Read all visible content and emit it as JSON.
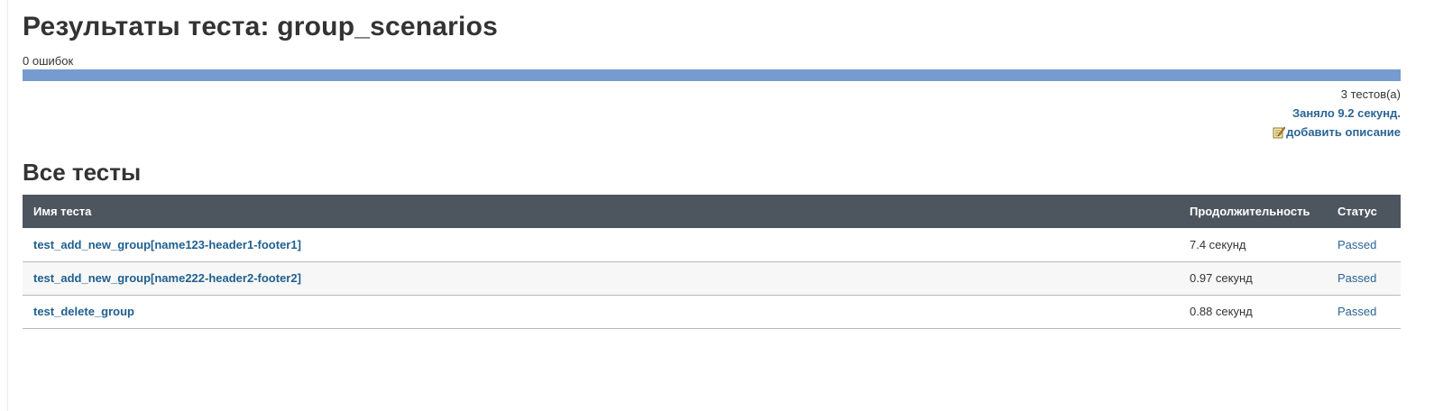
{
  "header": {
    "title": "Результаты теста: group_scenarios",
    "errors": "0 ошибок"
  },
  "progress": {
    "passed_fraction": 1.0,
    "color": "#769bcf"
  },
  "summary": {
    "test_count": "3 тестов(а)",
    "duration": "Заняло 9.2 секунд.",
    "add_description": "добавить описание",
    "add_description_icon": "edit-note-icon"
  },
  "section": {
    "title": "Все тесты"
  },
  "table": {
    "headers": {
      "name": "Имя теста",
      "duration": "Продолжительность",
      "status": "Статус"
    },
    "rows": [
      {
        "name": "test_add_new_group[name123-header1-footer1]",
        "duration": "7.4 секунд",
        "status": "Passed"
      },
      {
        "name": "test_add_new_group[name222-header2-footer2]",
        "duration": "0.97 секунд",
        "status": "Passed"
      },
      {
        "name": "test_delete_group",
        "duration": "0.88 секунд",
        "status": "Passed"
      }
    ]
  },
  "colors": {
    "header_bg": "#4d555f",
    "link": "#1f5f8f",
    "progress": "#769bcf"
  }
}
